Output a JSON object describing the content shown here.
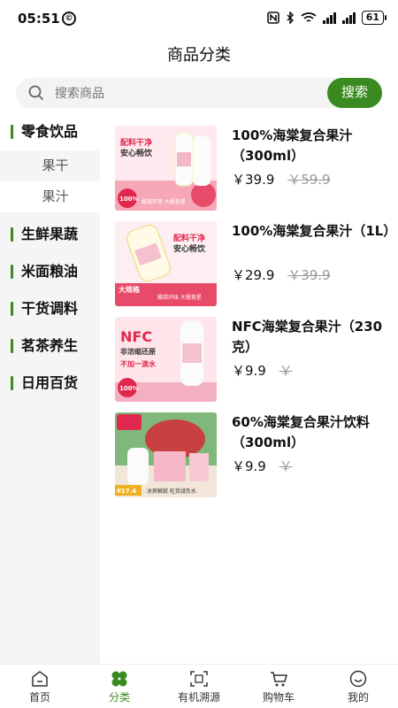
{
  "status": {
    "time": "05:51",
    "left_icon": "©",
    "battery": "61"
  },
  "header": {
    "title": "商品分类"
  },
  "search": {
    "placeholder": "搜索商品",
    "button_label": "搜索"
  },
  "sidebar": {
    "categories": [
      {
        "label": "零食饮品",
        "active": true,
        "subcategories": [
          {
            "label": "果干"
          },
          {
            "label": "果汁",
            "active": true
          }
        ]
      },
      {
        "label": "生鲜果蔬"
      },
      {
        "label": "米面粮油"
      },
      {
        "label": "干货调料"
      },
      {
        "label": "茗茶养生"
      },
      {
        "label": "日用百货"
      }
    ]
  },
  "products": [
    {
      "name": "100%海棠复合果汁（300ml）",
      "price": "￥39.9",
      "old_price": "￥59.9",
      "image_texts": [
        "配料干净",
        "安心畅饮",
        "100%",
        "酸甜开胃 大餐救星"
      ]
    },
    {
      "name": "100%海棠复合果汁（1L）",
      "price": "￥29.9",
      "old_price": "￥39.9",
      "image_texts": [
        "配料干净",
        "安心畅饮",
        "大规格",
        "酸甜开味 大餐救星"
      ]
    },
    {
      "name": "NFC海棠复合果汁（230克）",
      "price": "￥9.9",
      "old_price": "￥",
      "image_texts": [
        "NFC",
        "非浓缩还原",
        "不加一滴水",
        "100%"
      ]
    },
    {
      "name": "60%海棠复合果汁饮料（300ml）",
      "price": "￥9.9",
      "old_price": "￥",
      "image_texts": [
        "¥17.4",
        "冰爽解腻 吃货减负水"
      ]
    }
  ],
  "tabbar": {
    "items": [
      {
        "label": "首页",
        "icon": "home-icon"
      },
      {
        "label": "分类",
        "icon": "clover-icon",
        "active": true
      },
      {
        "label": "有机溯源",
        "icon": "scan-icon"
      },
      {
        "label": "购物车",
        "icon": "cart-icon"
      },
      {
        "label": "我的",
        "icon": "profile-icon"
      }
    ]
  },
  "colors": {
    "accent": "#3a8a21",
    "sidebar_bg": "#f5f5f5",
    "search_bg": "#f3f4f2"
  }
}
